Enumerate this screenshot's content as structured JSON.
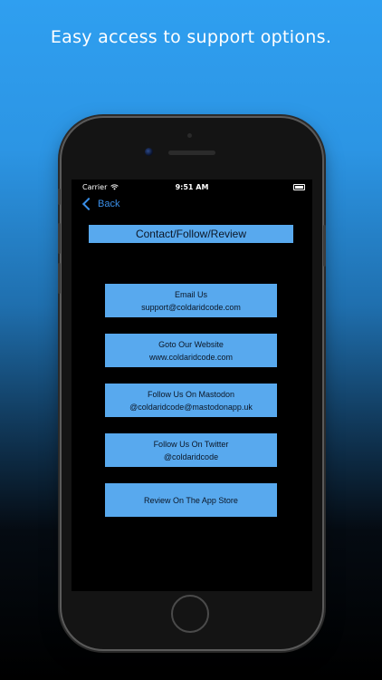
{
  "headline": "Easy access to support options.",
  "status_bar": {
    "carrier": "Carrier",
    "time": "9:51 AM"
  },
  "nav": {
    "back_label": "Back"
  },
  "page_title": "Contact/Follow/Review",
  "options": [
    {
      "line1": "Email Us",
      "line2": "support@coldaridcode.com"
    },
    {
      "line1": "Goto Our Website",
      "line2": "www.coldaridcode.com"
    },
    {
      "line1": "Follow Us On Mastodon",
      "line2": "@coldaridcode@mastodonapp.uk"
    },
    {
      "line1": "Follow Us On Twitter",
      "line2": "@coldaridcode"
    },
    {
      "line1": "Review On The App Store"
    }
  ],
  "colors": {
    "accent": "#58a9ee",
    "link": "#3a8fe8",
    "background_top": "#2f9ff0"
  }
}
